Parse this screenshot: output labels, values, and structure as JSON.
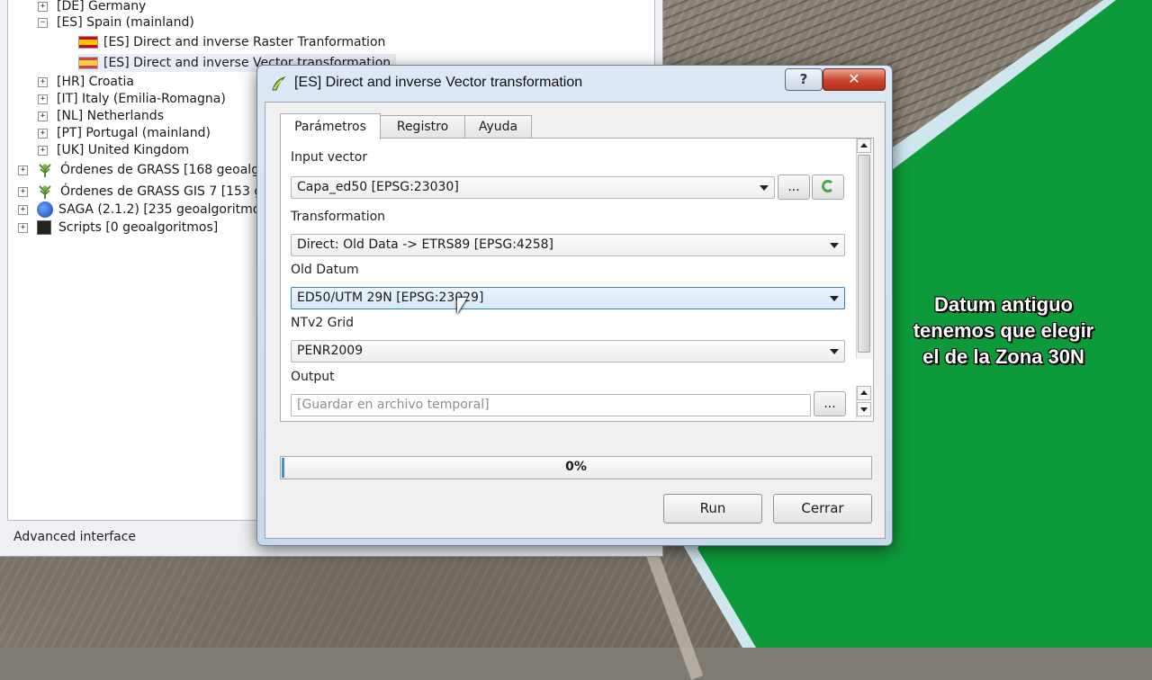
{
  "overlay": {
    "lines": [
      "Datum antiguo",
      "tenemos que elegir",
      "el de la Zona 30N"
    ]
  },
  "toolbox": {
    "tree": [
      {
        "label": "[DE] Germany",
        "level": 2,
        "expander": "+"
      },
      {
        "label": "[ES] Spain (mainland)",
        "level": 2,
        "expander": "−"
      },
      {
        "label": "[ES] Direct and inverse Raster Tranformation",
        "level": 3,
        "icon": "spain-flag-icon"
      },
      {
        "label": "[ES] Direct and inverse Vector transformation",
        "level": 3,
        "icon": "spain-flag-icon",
        "selected": true
      },
      {
        "label": "[HR] Croatia",
        "level": 2,
        "expander": "+"
      },
      {
        "label": "[IT] Italy (Emilia-Romagna)",
        "level": 2,
        "expander": "+"
      },
      {
        "label": "[NL] Netherlands",
        "level": 2,
        "expander": "+"
      },
      {
        "label": "[PT] Portugal (mainland)",
        "level": 2,
        "expander": "+"
      },
      {
        "label": "[UK] United Kingdom",
        "level": 2,
        "expander": "+"
      },
      {
        "label": "Órdenes de GRASS [168 geoalgo",
        "level": 1,
        "expander": "+",
        "icon": "grass-icon"
      },
      {
        "label": "Órdenes de GRASS GIS 7 [153 g",
        "level": 1,
        "expander": "+",
        "icon": "grass-icon"
      },
      {
        "label": "SAGA (2.1.2) [235 geoalgoritmo",
        "level": 1,
        "expander": "+",
        "icon": "saga-icon"
      },
      {
        "label": "Scripts [0 geoalgoritmos]",
        "level": 1,
        "expander": "+",
        "icon": "scripts-icon"
      }
    ],
    "advanced_label": "Advanced interface"
  },
  "dialog": {
    "title": "[ES] Direct and inverse Vector transformation",
    "help_label": "?",
    "close_label": "✕",
    "tabs": [
      "Parámetros",
      "Registro",
      "Ayuda"
    ],
    "active_tab": 0,
    "fields": {
      "input_vector_label": "Input vector",
      "input_vector_value": "Capa_ed50 [EPSG:23030]",
      "browse_label": "...",
      "transformation_label": "Transformation",
      "transformation_value": "Direct: Old Data -> ETRS89 [EPSG:4258]",
      "old_datum_label": "Old Datum",
      "old_datum_value": "ED50/UTM 29N [EPSG:23029]",
      "ntv2_label": "NTv2 Grid",
      "ntv2_value": "PENR2009",
      "output_label": "Output",
      "output_placeholder": "[Guardar en archivo temporal]",
      "output_browse_label": "..."
    },
    "progress": {
      "value": 0.0,
      "text": "0%"
    },
    "buttons": {
      "run": "Run",
      "close": "Cerrar"
    }
  }
}
